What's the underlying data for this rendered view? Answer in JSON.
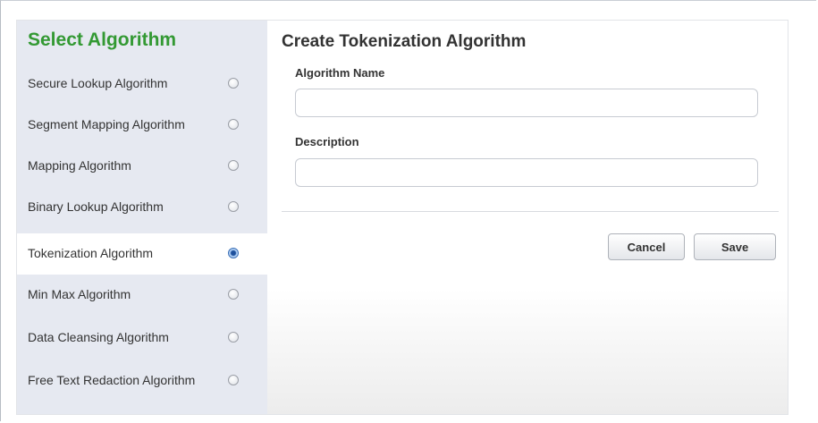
{
  "sidebar": {
    "title": "Select Algorithm",
    "items": [
      {
        "label": "Secure Lookup Algorithm",
        "selected": false
      },
      {
        "label": "Segment Mapping Algorithm",
        "selected": false
      },
      {
        "label": "Mapping Algorithm",
        "selected": false
      },
      {
        "label": "Binary Lookup Algorithm",
        "selected": false
      },
      {
        "label": "Tokenization Algorithm",
        "selected": true
      },
      {
        "label": "Min Max Algorithm",
        "selected": false
      },
      {
        "label": "Data Cleansing Algorithm",
        "selected": false
      },
      {
        "label": "Free Text Redaction Algorithm",
        "selected": false
      }
    ]
  },
  "form": {
    "title": "Create Tokenization Algorithm",
    "name_label": "Algorithm Name",
    "name_value": "",
    "description_label": "Description",
    "description_value": ""
  },
  "buttons": {
    "cancel": "Cancel",
    "save": "Save"
  },
  "colors": {
    "sidebar_title": "#339933",
    "sidebar_bg": "#e6e9f1",
    "selected_radio": "#1d4f9c"
  }
}
